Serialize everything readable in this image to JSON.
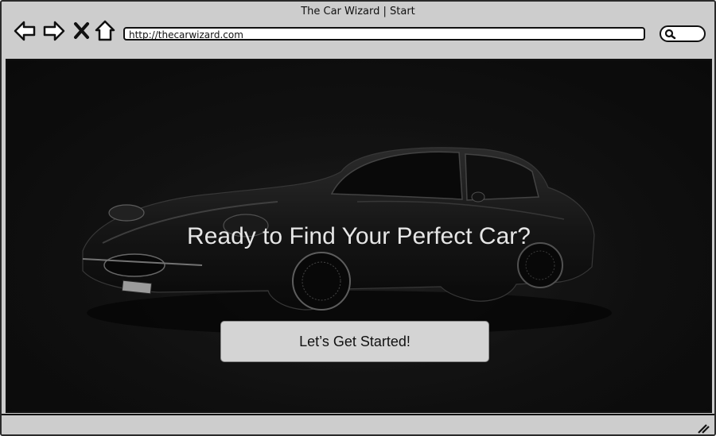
{
  "window": {
    "title": "The Car Wizard | Start"
  },
  "toolbar": {
    "back_icon": "arrow-left-icon",
    "forward_icon": "arrow-right-icon",
    "stop_icon": "close-icon",
    "home_icon": "home-icon",
    "url": "http://thecarwizard.com",
    "search_icon": "search-icon"
  },
  "hero": {
    "headline": "Ready to Find Your Perfect Car?",
    "cta_label": "Let’s Get Started!",
    "background": "dark-sports-car-photo"
  }
}
